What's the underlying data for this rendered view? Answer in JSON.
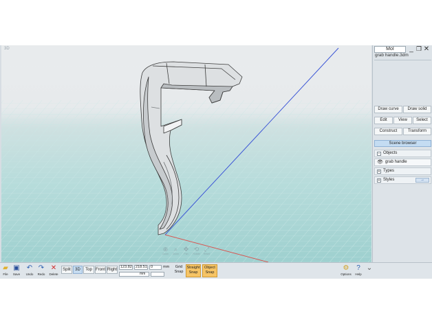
{
  "viewport": {
    "label": "3D",
    "nav": [
      {
        "icon": "zoom-icon",
        "label": "Zoom"
      },
      {
        "icon": "magnify-icon",
        "label": "Zoom"
      },
      {
        "icon": "pan-icon",
        "label": "Pan"
      },
      {
        "icon": "rotate-icon",
        "label": "Rotate"
      },
      {
        "icon": "reset-icon",
        "label": "Reset"
      }
    ]
  },
  "panel": {
    "app_name": "MoI",
    "file_name": "grab handle.3dm",
    "rows": [
      [
        "Draw curve",
        "Draw solid"
      ],
      [
        "Edit",
        "View",
        "Select"
      ],
      [
        "Construct",
        "Transform"
      ]
    ],
    "scene_browser": "Scene browser",
    "objects_label": "Objects",
    "object_item": "grab handle",
    "types_label": "Types",
    "styles_label": "Styles",
    "styles_arrow": "→"
  },
  "toolbar": {
    "file": "File",
    "save": "Save",
    "undo": "Undo",
    "redo": "Redo",
    "delete": "Delete",
    "split": "Split",
    "view_3d": "3D",
    "top": "Top",
    "front": "Front",
    "right": "Right",
    "coord_x": "123.82",
    "coord_y": "218.51",
    "coord_z": "0",
    "units": "mm",
    "input_value": "",
    "input_units": "mm",
    "grid_snap_1": "Grid",
    "grid_snap_2": "Snap",
    "straight_snap_1": "Straight",
    "straight_snap_2": "Snap",
    "object_snap_1": "Object",
    "object_snap_2": "Snap",
    "options": "Options",
    "help": "Help"
  },
  "colors": {
    "accent_snap": "#f6c465",
    "active_view": "#c6dcf0",
    "grid_bg": "#a6d4d3",
    "axis_x": "#d9534f",
    "axis_y": "#3c56d6"
  }
}
